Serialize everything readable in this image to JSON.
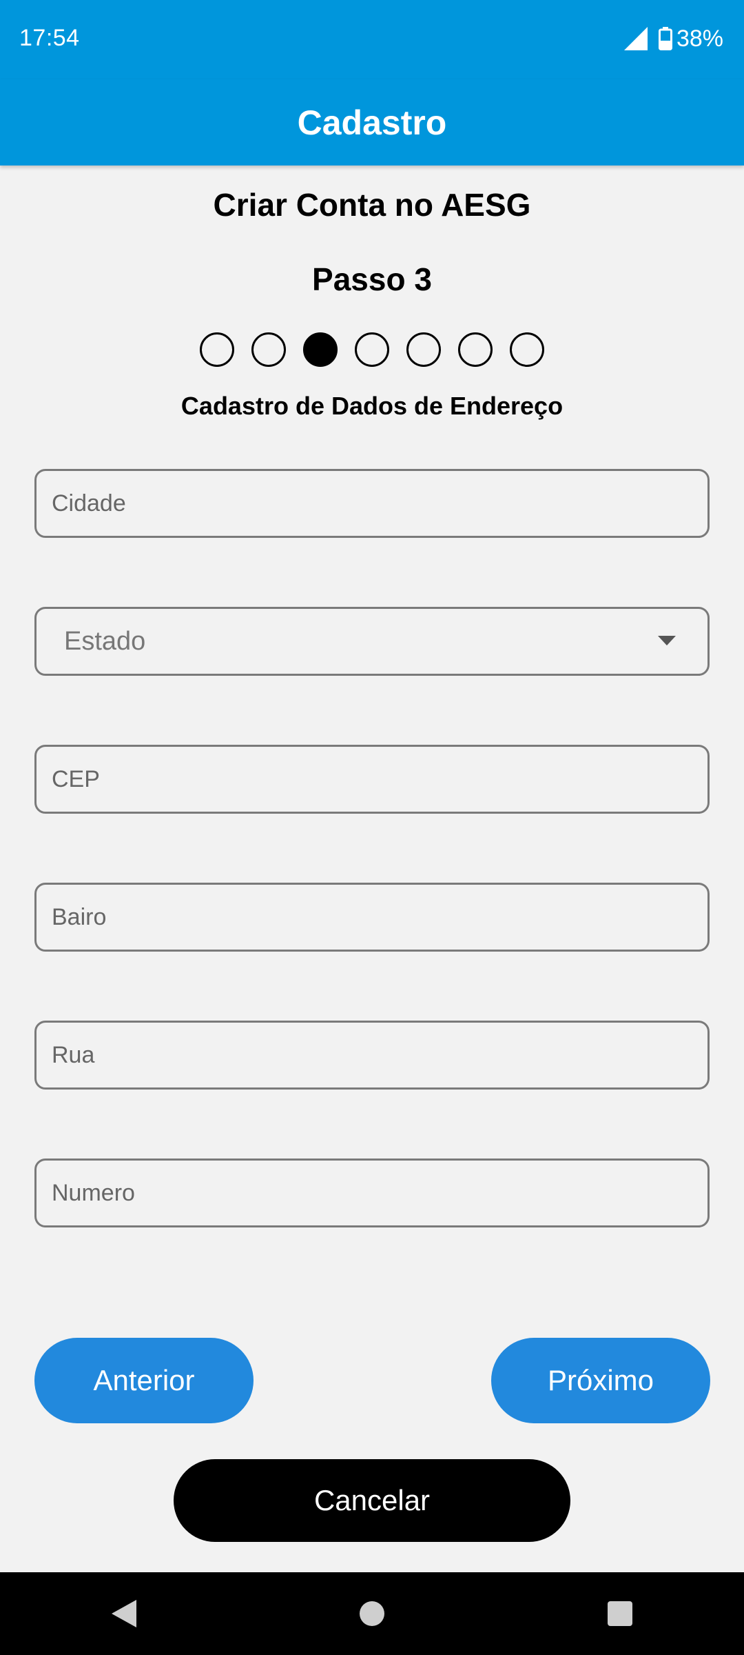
{
  "status": {
    "time": "17:54",
    "battery": "38%"
  },
  "appbar": {
    "title": "Cadastro"
  },
  "header": {
    "account_title": "Criar Conta no AESG",
    "step_label": "Passo 3",
    "section_title": "Cadastro de Dados de Endereço"
  },
  "stepper": {
    "total_steps": 7,
    "current_step": 3
  },
  "form": {
    "cidade": {
      "placeholder": "Cidade",
      "value": ""
    },
    "estado": {
      "selected": "Estado"
    },
    "cep": {
      "placeholder": "CEP",
      "value": ""
    },
    "bairro": {
      "placeholder": "Bairo",
      "value": ""
    },
    "rua": {
      "placeholder": "Rua",
      "value": ""
    },
    "numero": {
      "placeholder": "Numero",
      "value": ""
    }
  },
  "buttons": {
    "prev_label": "Anterior",
    "next_label": "Próximo",
    "cancel_label": "Cancelar"
  },
  "colors": {
    "primary": "#0096dc",
    "button": "#2289dd",
    "cancel": "#000000",
    "background": "#f2f2f2"
  },
  "icons": {
    "signal": "signal-icon",
    "battery": "battery-icon",
    "dropdown": "chevron-down-icon",
    "back": "back-icon",
    "home": "home-icon",
    "recents": "recents-icon"
  }
}
